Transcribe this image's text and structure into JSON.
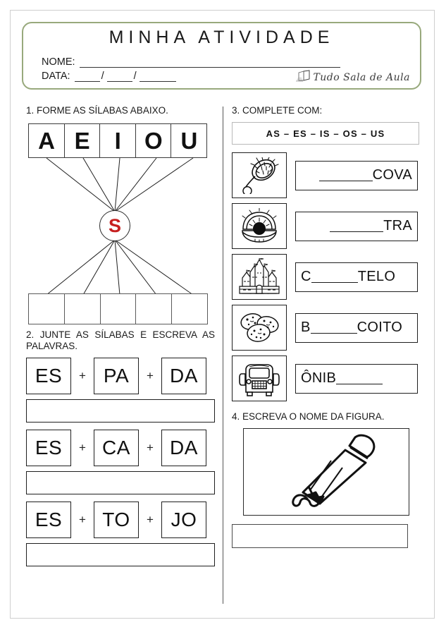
{
  "header": {
    "title": "MINHA ATIVIDADE",
    "nome_label": "NOME:",
    "data_label": "DATA:",
    "slash": "/",
    "brand_text": "Tudo Sala de Aula",
    "border_color": "#98a97c"
  },
  "section1": {
    "instruction": "1. FORME AS SÍLABAS ABAIXO.",
    "vowels": [
      "A",
      "E",
      "I",
      "O",
      "U"
    ],
    "center_letter": "S",
    "center_letter_color": "#c62020",
    "blank_boxes": 5
  },
  "section2": {
    "instruction": "2. JUNTE AS SÍLABAS E ESCREVA AS PALAVRAS.",
    "plus": "+",
    "rows": [
      {
        "a": "ES",
        "b": "PA",
        "c": "DA"
      },
      {
        "a": "ES",
        "b": "CA",
        "c": "DA"
      },
      {
        "a": "ES",
        "b": "TO",
        "c": "JO"
      }
    ]
  },
  "section3": {
    "instruction": "3. COMPLETE COM:",
    "word_bank": "AS  –  ES  –  IS  –  OS  –  US",
    "items": [
      {
        "icon": "hairbrush-icon",
        "prefix": "",
        "suffix": "COVA",
        "align": "right"
      },
      {
        "icon": "oyster-shell-icon",
        "prefix": "",
        "suffix": "TRA",
        "align": "right"
      },
      {
        "icon": "castle-icon",
        "prefix": "C",
        "suffix": "TELO",
        "align": "left"
      },
      {
        "icon": "cookies-icon",
        "prefix": "B",
        "suffix": "COITO",
        "align": "left"
      },
      {
        "icon": "bus-icon",
        "prefix": "ÔNIB",
        "suffix": "",
        "align": "left"
      }
    ]
  },
  "section4": {
    "instruction": "4. ESCREVA O NOME DA FIGURA.",
    "figure_icon": "pencil-icon"
  }
}
